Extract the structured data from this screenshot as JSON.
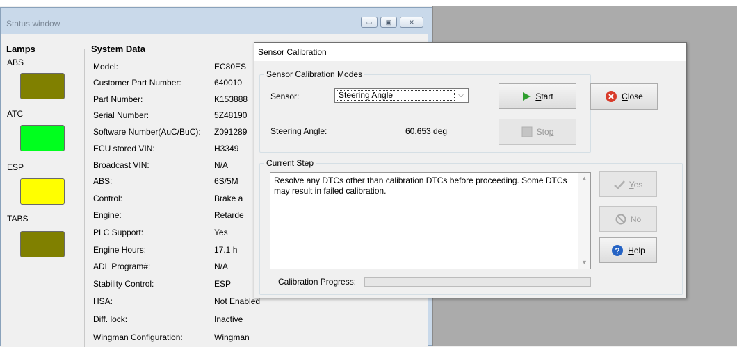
{
  "status_window": {
    "title": "Status window",
    "controls": {
      "minimize": "▭",
      "maximize": "▣",
      "close": "✕"
    },
    "lamps": {
      "title": "Lamps",
      "items": [
        {
          "label": "ABS",
          "color": "#808000"
        },
        {
          "label": "ATC",
          "color": "#00ff1e"
        },
        {
          "label": "ESP",
          "color": "#ffff00"
        },
        {
          "label": "TABS",
          "color": "#808000"
        }
      ]
    },
    "system_data": {
      "title": "System Data",
      "rows": [
        {
          "label": "Model:",
          "value": "EC80ES"
        },
        {
          "label": "Customer Part Number:",
          "value": "640010"
        },
        {
          "label": "Part Number:",
          "value": "K153888"
        },
        {
          "label": "Serial Number:",
          "value": "5Z48190"
        },
        {
          "label": "Software Number(AuC/BuC):",
          "value": "Z091289"
        },
        {
          "label": "ECU stored VIN:",
          "value": "H3349"
        },
        {
          "label": "Broadcast VIN:",
          "value": "N/A"
        },
        {
          "label": "ABS:",
          "value": "6S/5M"
        },
        {
          "label": "Control:",
          "value": "Brake a"
        },
        {
          "label": "Engine:",
          "value": "Retarde"
        },
        {
          "label": "PLC Support:",
          "value": "Yes"
        },
        {
          "label": "Engine Hours:",
          "value": "17.1  h"
        },
        {
          "label": "ADL Program#:",
          "value": "N/A"
        },
        {
          "label": "Stability Control:",
          "value": "ESP"
        },
        {
          "label": "HSA:",
          "value": "Not Enabled"
        },
        {
          "label": "Diff. lock:",
          "value": "Inactive"
        },
        {
          "label": "Wingman Configuration:",
          "value": "Wingman"
        }
      ]
    }
  },
  "sensor_dialog": {
    "title": "Sensor Calibration",
    "modes_group": "Sensor Calibration Modes",
    "sensor_label": "Sensor:",
    "sensor_selected": "Steering Angle",
    "angle_label": "Steering Angle:",
    "angle_value": "60.653 deg",
    "start_button": {
      "pre": "",
      "key": "S",
      "post": "tart"
    },
    "stop_button": {
      "pre": "Sto",
      "key": "p",
      "post": ""
    },
    "close_button": {
      "pre": "",
      "key": "C",
      "post": "lose"
    },
    "current_step_group": "Current Step",
    "step_text": "Resolve any DTCs other than calibration DTCs before proceeding. Some DTCs may result in failed calibration.",
    "progress_label": "Calibration Progress:",
    "progress_fraction": 0,
    "yes_button": {
      "pre": "",
      "key": "Y",
      "post": "es"
    },
    "no_button": {
      "pre": "",
      "key": "N",
      "post": "o"
    },
    "help_button": {
      "pre": "",
      "key": "H",
      "post": "elp"
    },
    "colors": {
      "start_icon": "#2e9e2e",
      "close_icon": "#d83b2a",
      "help_icon": "#2563c4"
    },
    "icons": {
      "start": "play-icon",
      "stop": "stop-icon",
      "close": "close-circle-icon",
      "yes": "checkmark-icon",
      "no": "no-entry-icon",
      "help": "help-icon"
    }
  }
}
